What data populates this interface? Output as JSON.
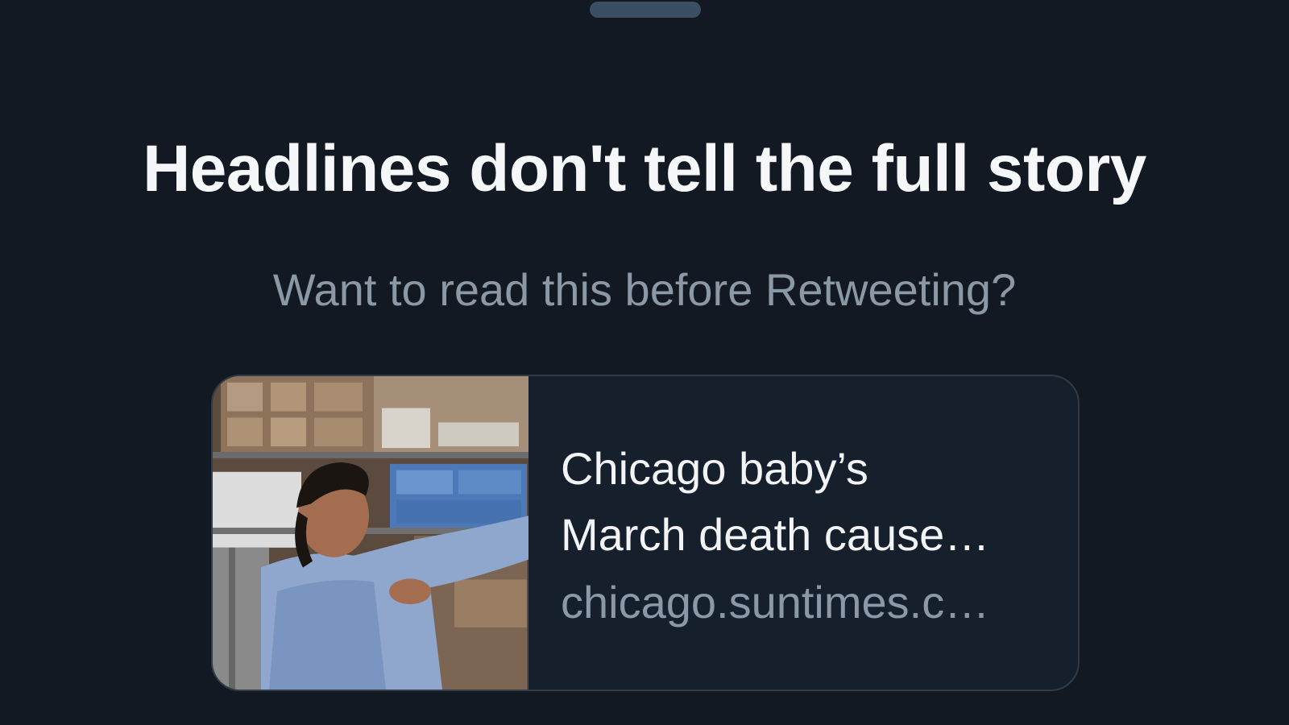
{
  "prompt": {
    "headline": "Headlines don't tell the full story",
    "subtitle": "Want to read this before Retweeting?"
  },
  "article_card": {
    "title": "Chicago baby’s\nMarch death cause…",
    "domain": "chicago.suntimes.c…",
    "thumbnail_icon": "article-photo"
  },
  "colors": {
    "background": "#131922",
    "headline": "#f5f7f9",
    "secondary_text": "#8b98a5",
    "card_border": "#2f3b47",
    "grabber": "#3a4f62"
  }
}
